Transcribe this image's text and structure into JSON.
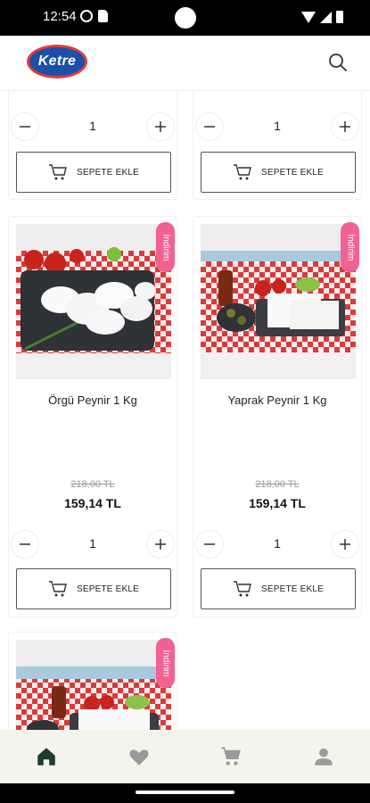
{
  "status_bar": {
    "time": "12:54"
  },
  "header": {
    "logo_text": "Ketre"
  },
  "products": [
    {
      "name": "",
      "old_price": "",
      "new_price": "",
      "quantity": "1",
      "add_label": "SEPETE EKLE"
    },
    {
      "name": "",
      "old_price": "",
      "new_price": "",
      "quantity": "1",
      "add_label": "SEPETE EKLE"
    },
    {
      "name": "Örgü Peynir 1 Kg",
      "badge": "İndirim",
      "old_price": "218,00 TL",
      "new_price": "159,14 TL",
      "quantity": "1",
      "add_label": "SEPETE EKLE"
    },
    {
      "name": "Yaprak Peynir 1 Kg",
      "badge": "İndirim",
      "old_price": "218,00 TL",
      "new_price": "159,14 TL",
      "quantity": "1",
      "add_label": "SEPETE EKLE"
    },
    {
      "name": "",
      "badge": "İndirim"
    }
  ],
  "bottom_nav": [
    {
      "icon": "home-icon",
      "active": true
    },
    {
      "icon": "heart-icon",
      "active": false
    },
    {
      "icon": "cart-icon",
      "active": false
    },
    {
      "icon": "user-icon",
      "active": false
    }
  ],
  "colors": {
    "badge": "#f06292",
    "logo_blue": "#1c4fa8",
    "logo_red": "#e23a3a",
    "nav_bg": "#f4f4ec",
    "nav_active": "#1d3d2f",
    "nav_inactive": "#9a9a9a"
  }
}
